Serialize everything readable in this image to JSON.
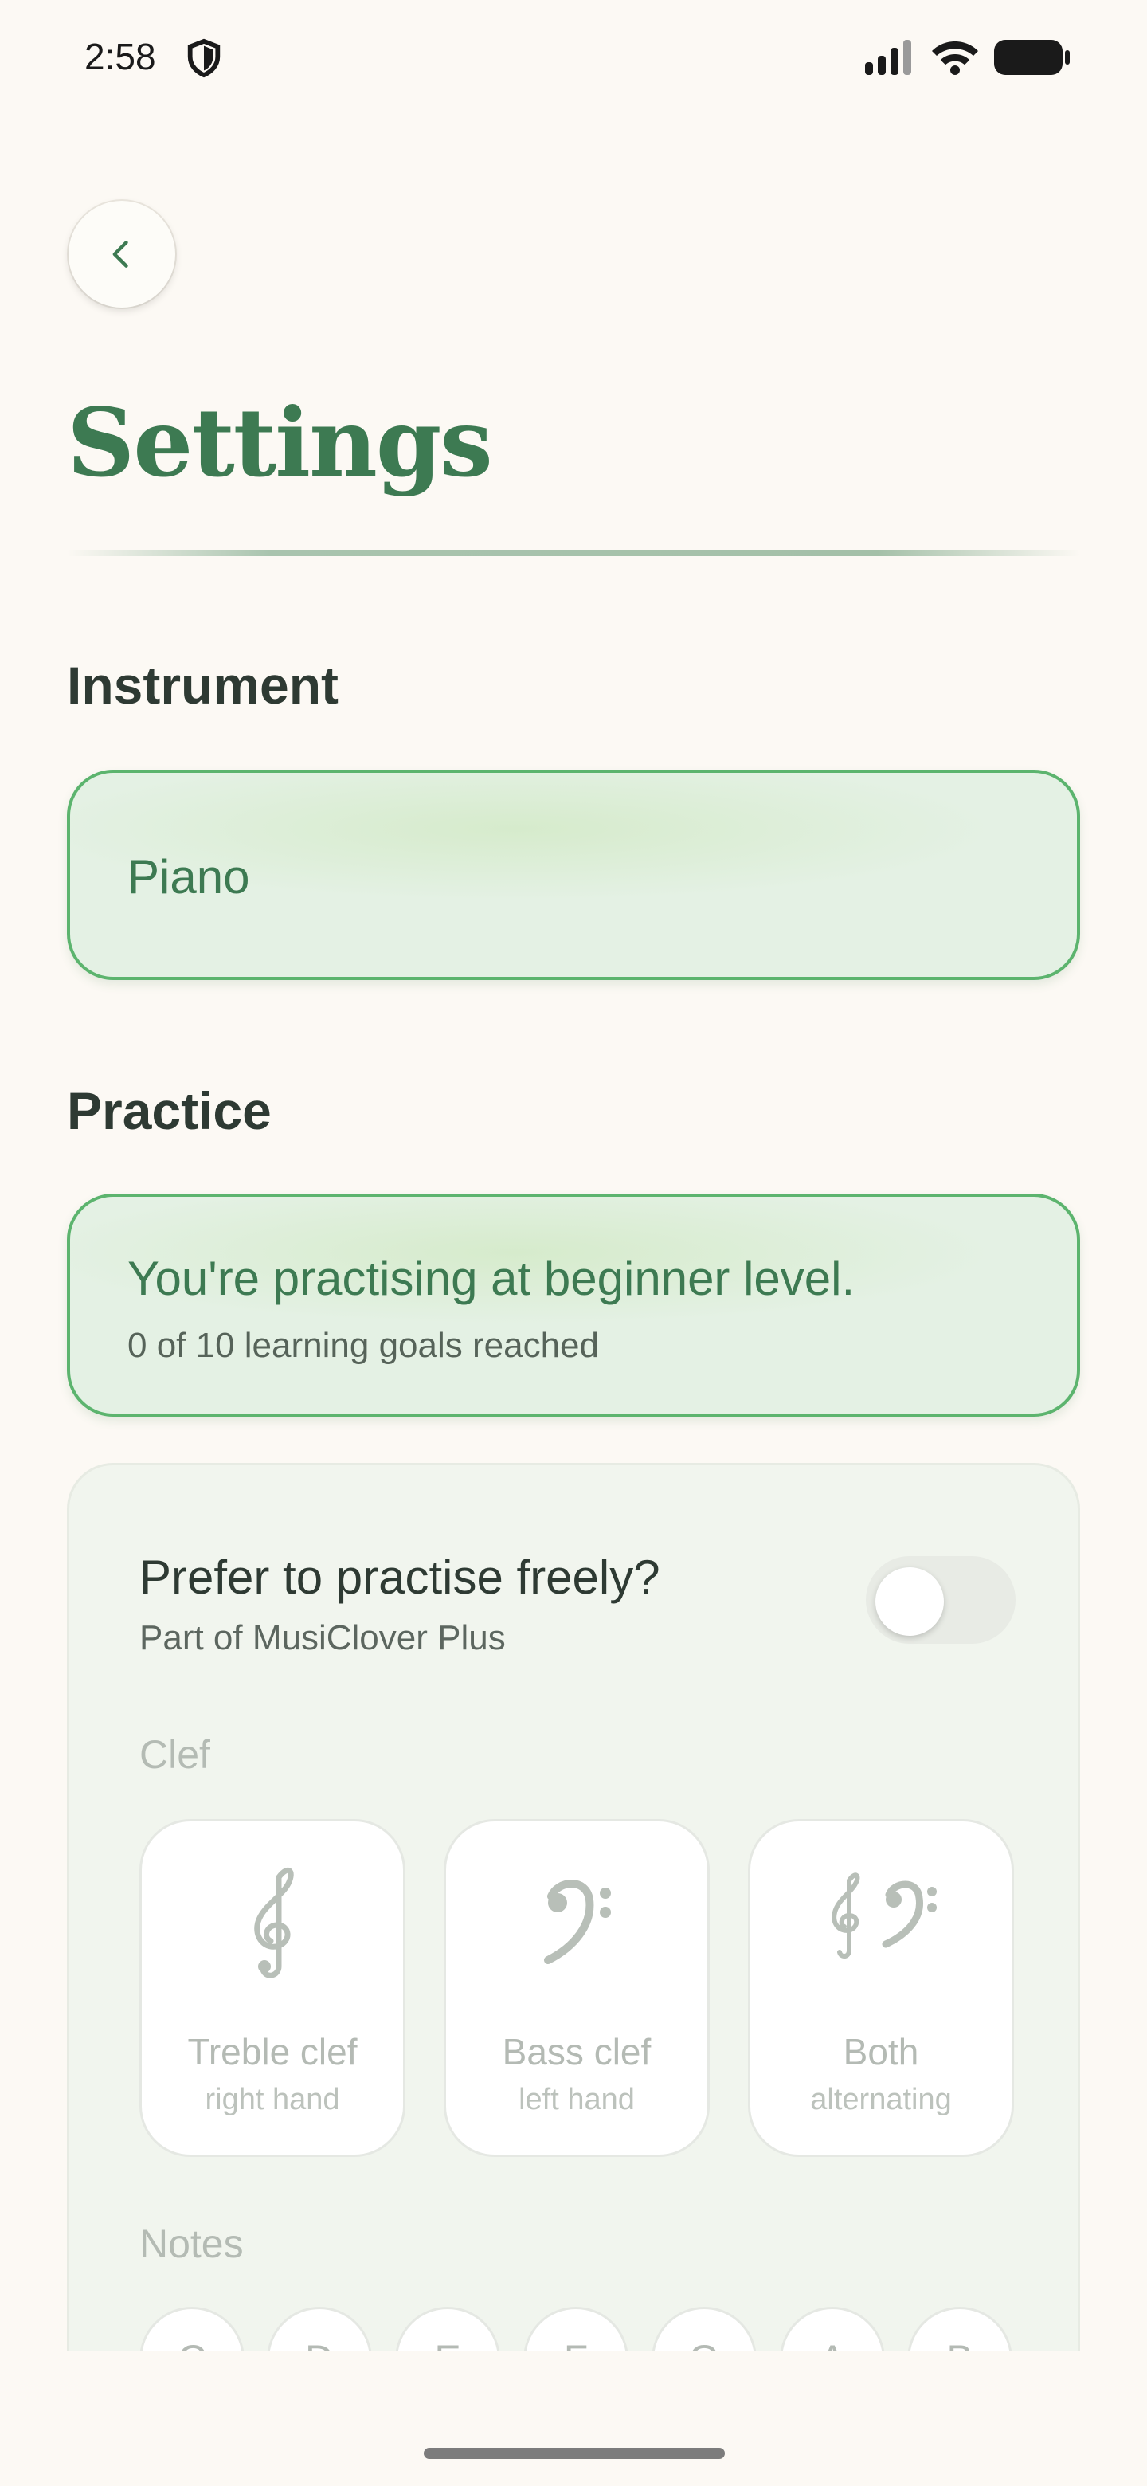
{
  "status_bar": {
    "time": "2:58",
    "icons": [
      "shield-icon",
      "signal-icon",
      "wifi-icon",
      "battery-icon"
    ]
  },
  "header": {
    "back_icon": "chevron-left-icon",
    "title": "Settings"
  },
  "instrument": {
    "heading": "Instrument",
    "selected": "Piano"
  },
  "practice": {
    "heading": "Practice",
    "level_title": "You're practising at beginner level.",
    "level_subtitle": "0 of 10 learning goals reached",
    "free_practice": {
      "title": "Prefer to practise freely?",
      "subtitle": "Part of MusiClover Plus",
      "enabled": false
    },
    "clef": {
      "label": "Clef",
      "options": [
        {
          "name": "Treble clef",
          "hint": "right hand",
          "icon": "treble-clef-icon"
        },
        {
          "name": "Bass clef",
          "hint": "left hand",
          "icon": "bass-clef-icon"
        },
        {
          "name": "Both",
          "hint": "alternating",
          "icon": "treble-and-bass-clef-icon"
        }
      ]
    },
    "notes": {
      "label": "Notes",
      "items": [
        "C",
        "D",
        "E",
        "F",
        "G",
        "A",
        "B"
      ]
    }
  },
  "colors": {
    "accent": "#3d7a52",
    "card_border": "#5cb46e",
    "background": "#fcf9f4"
  }
}
